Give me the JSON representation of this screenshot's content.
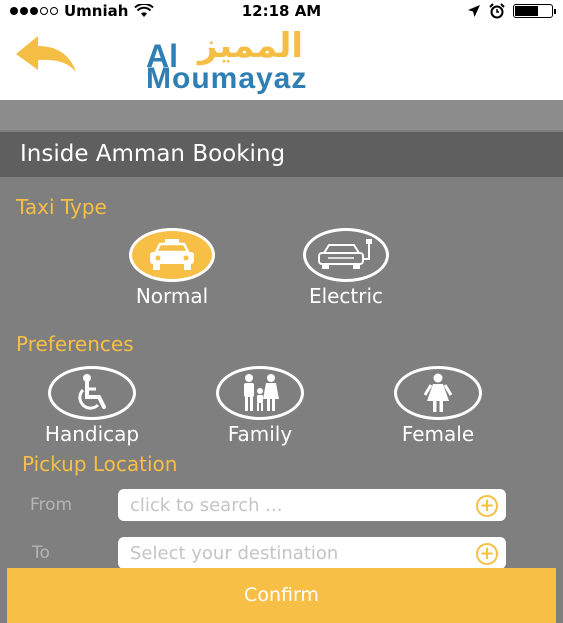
{
  "status_bar": {
    "carrier": "Umniah",
    "time": "12:18 AM"
  },
  "header": {
    "logo_arabic": "المميز",
    "logo_al": "Al",
    "logo_moumayaz": "Moumayaz"
  },
  "page": {
    "title": "Inside Amman Booking"
  },
  "taxi_type": {
    "label": "Taxi Type",
    "options": [
      {
        "label": "Normal",
        "icon": "taxi-icon",
        "selected": true
      },
      {
        "label": "Electric",
        "icon": "electric-car-icon",
        "selected": false
      }
    ]
  },
  "preferences": {
    "label": "Preferences",
    "options": [
      {
        "label": "Handicap",
        "icon": "wheelchair-icon"
      },
      {
        "label": "Family",
        "icon": "family-icon"
      },
      {
        "label": "Female",
        "icon": "female-icon"
      }
    ]
  },
  "pickup": {
    "label": "Pickup Location",
    "from_label": "From",
    "from_placeholder": "click to search ...",
    "to_label": "To",
    "to_placeholder": "Select your destination"
  },
  "confirm_label": "Confirm",
  "colors": {
    "accent": "#f7bf46",
    "background": "#7f7f7f",
    "title_bar": "#5f5f5f",
    "brand_blue": "#2f7fb5"
  }
}
